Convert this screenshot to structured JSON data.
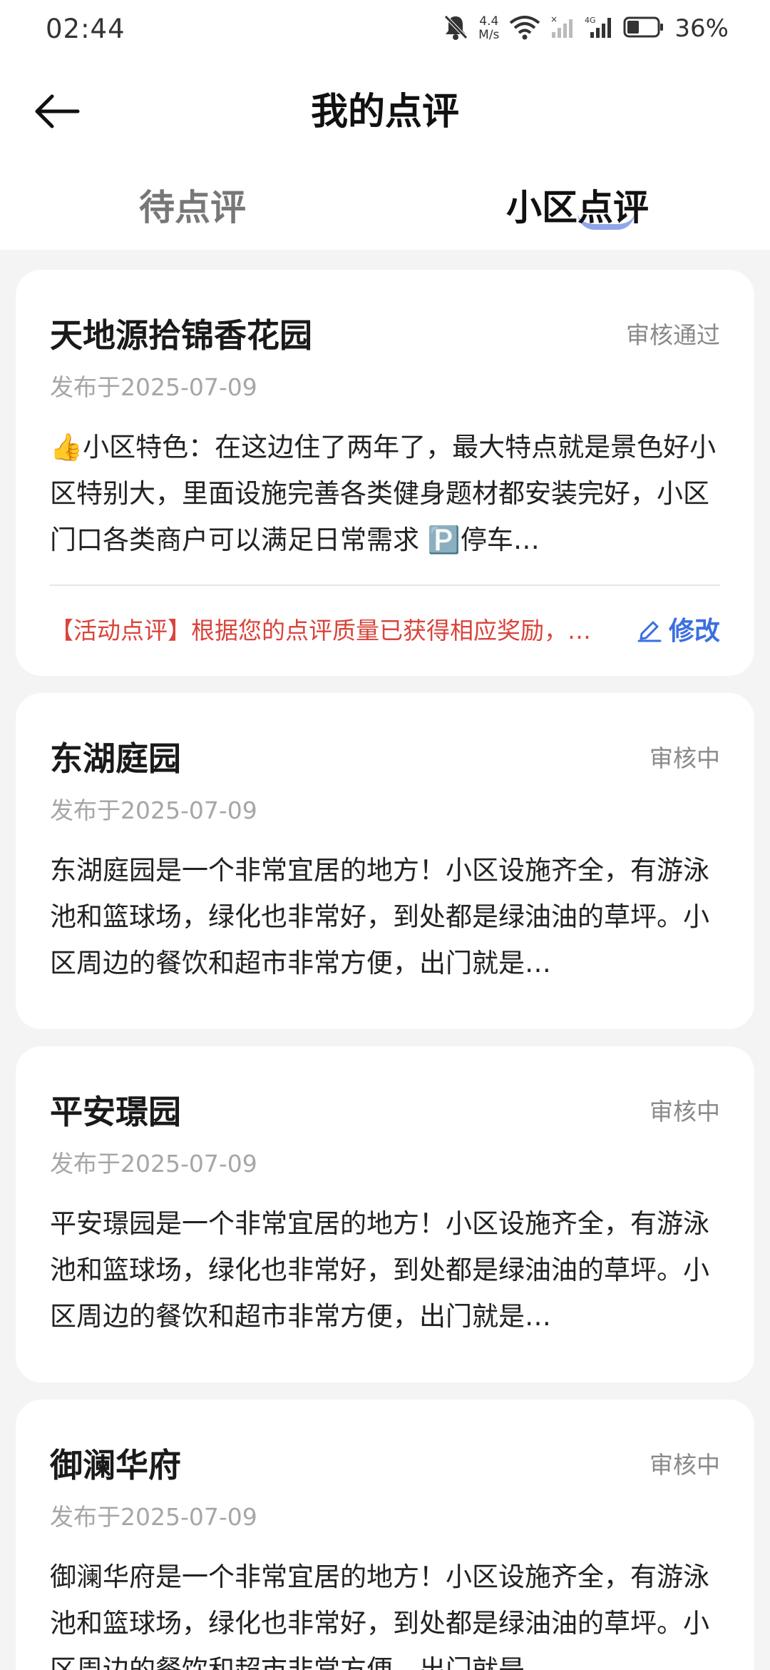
{
  "status_bar": {
    "time": "02:44",
    "speed_value": "4.4",
    "speed_unit": "M/s",
    "battery": "36%"
  },
  "header": {
    "title": "我的点评"
  },
  "tabs": [
    {
      "label": "待点评",
      "active": false
    },
    {
      "label": "小区点评",
      "active": true
    }
  ],
  "reviews": [
    {
      "name": "天地源拾锦香花园",
      "status": "审核通过",
      "date": "发布于2025-07-09",
      "text": "👍小区特色：在这边住了两年了，最大特点就是景色好小区特别大，里面设施完善各类健身题材都安装完好，小区门口各类商户可以满足日常需求 🅿️停车…",
      "activity_note": "【活动点评】根据您的点评质量已获得相应奖励，…",
      "edit_label": "修改"
    },
    {
      "name": "东湖庭园",
      "status": "审核中",
      "date": "发布于2025-07-09",
      "text": "东湖庭园是一个非常宜居的地方！小区设施齐全，有游泳池和篮球场，绿化也非常好，到处都是绿油油的草坪。小区周边的餐饮和超市非常方便，出门就是…"
    },
    {
      "name": "平安璟园",
      "status": "审核中",
      "date": "发布于2025-07-09",
      "text": "平安璟园是一个非常宜居的地方！小区设施齐全，有游泳池和篮球场，绿化也非常好，到处都是绿油油的草坪。小区周边的餐饮和超市非常方便，出门就是…"
    },
    {
      "name": "御澜华府",
      "status": "审核中",
      "date": "发布于2025-07-09",
      "text": "御澜华府是一个非常宜居的地方！小区设施齐全，有游泳池和篮球场，绿化也非常好，到处都是绿油油的草坪。小区周边的餐饮和超市非常方便，出门就是…"
    }
  ],
  "colors": {
    "accent": "#3a6fe0",
    "activity": "#d9443b",
    "background": "#f4f4f4"
  }
}
